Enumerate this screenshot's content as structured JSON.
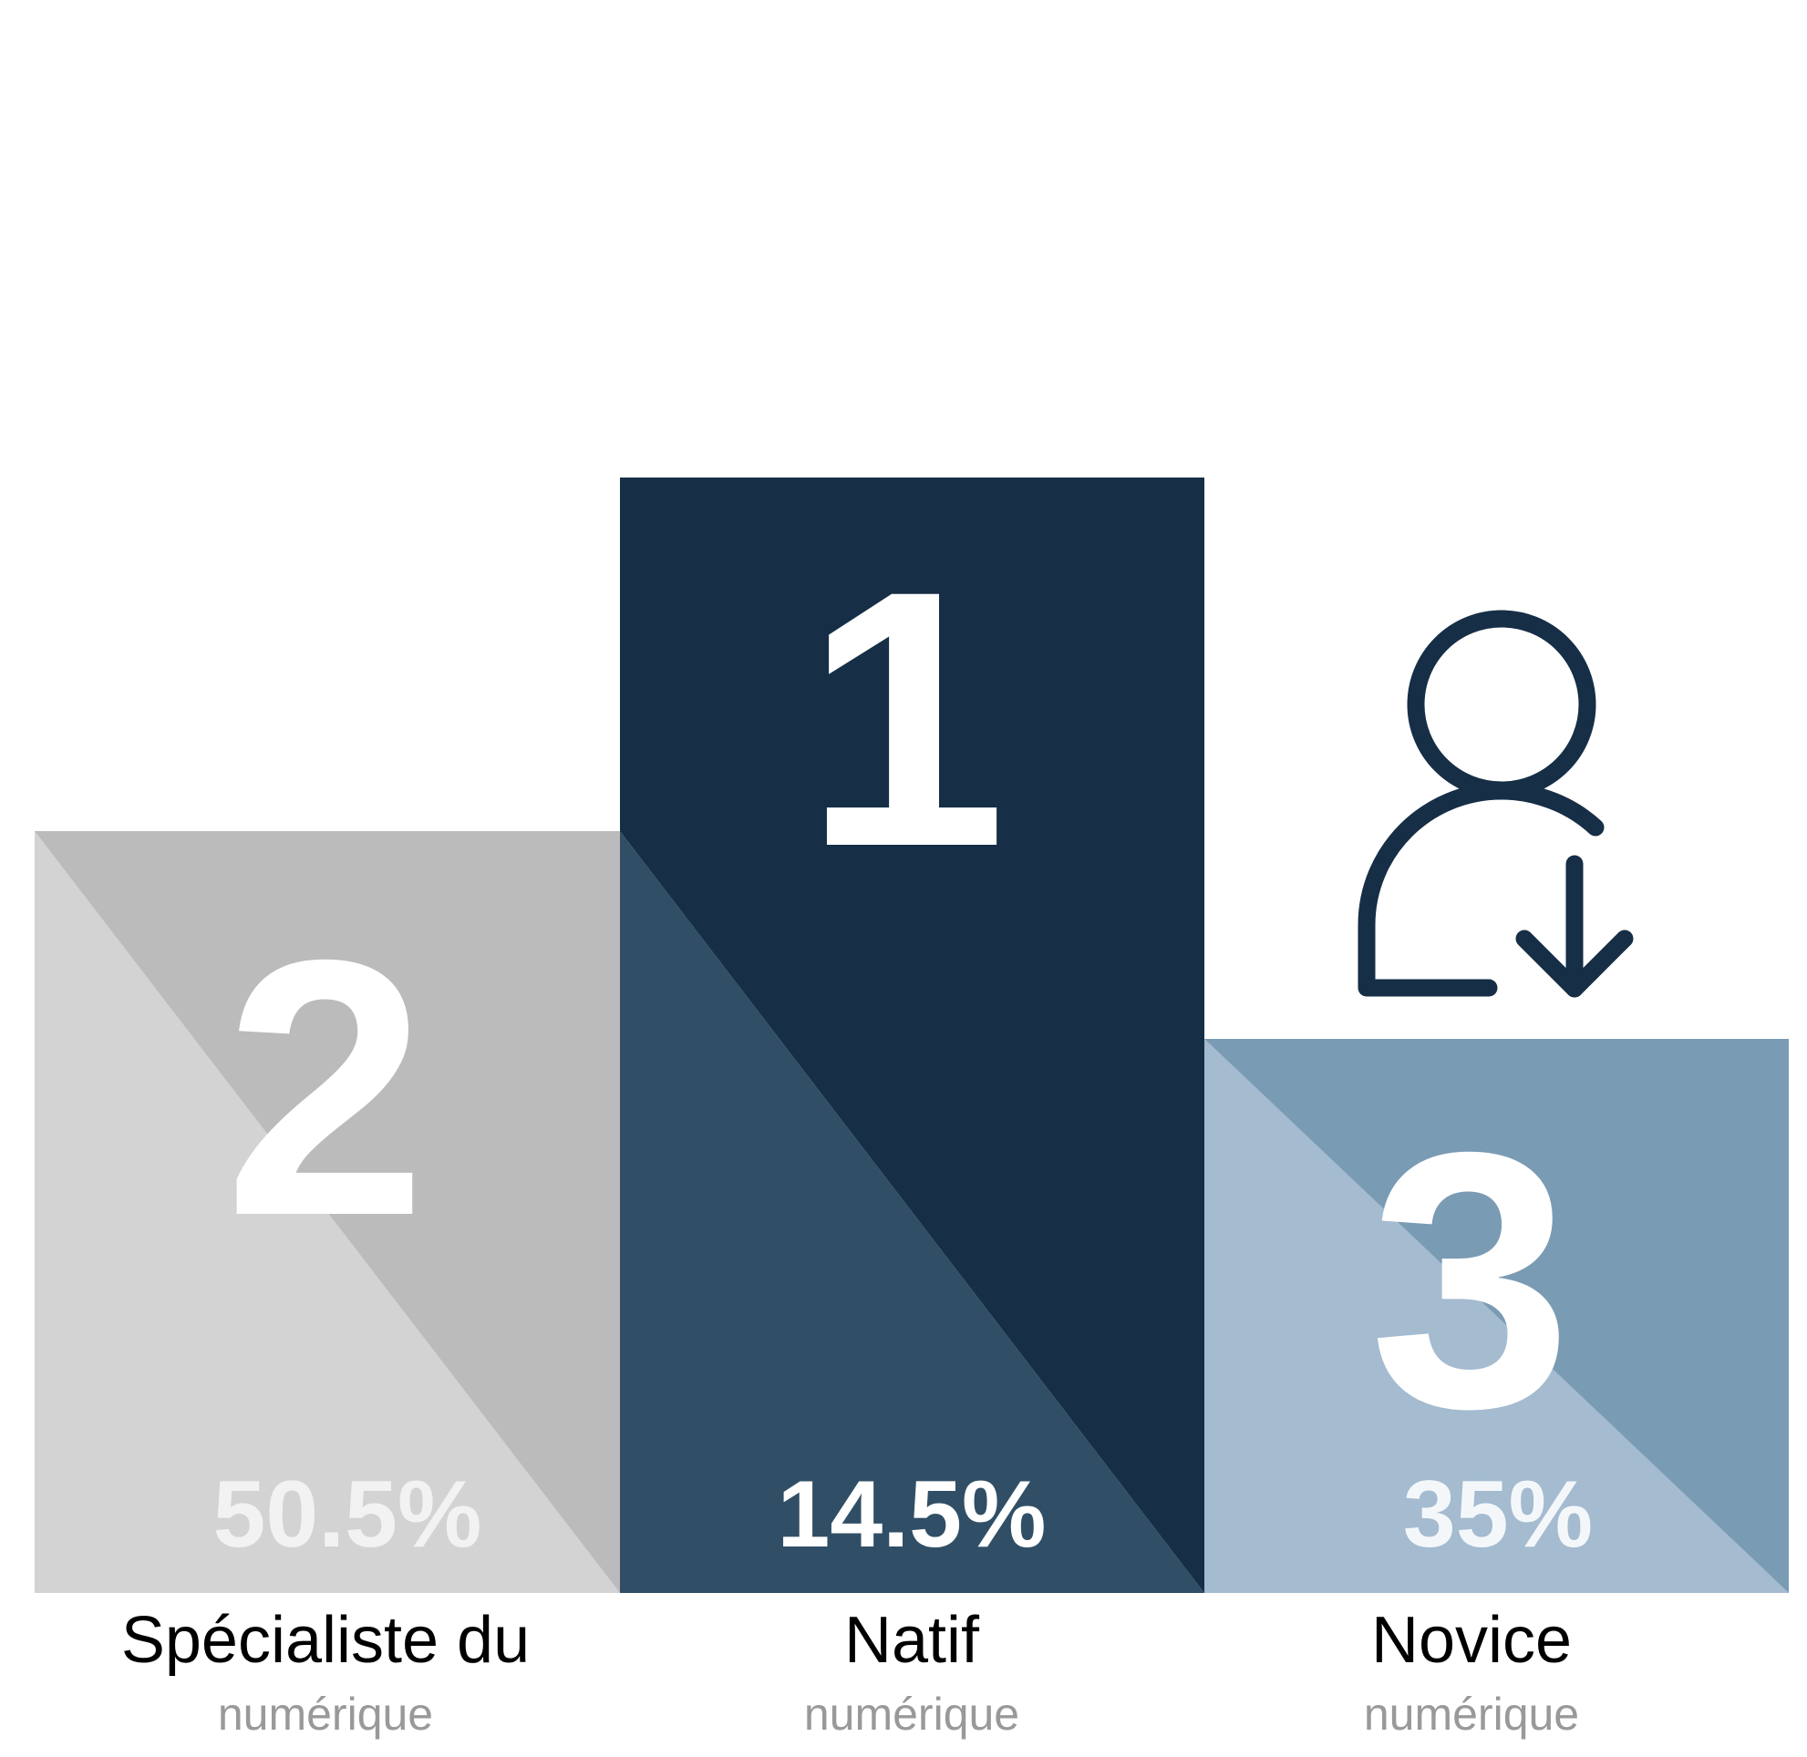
{
  "chart_data": {
    "type": "bar",
    "categories": [
      "Spécialiste du numérique",
      "Natif numérique",
      "Novice numérique"
    ],
    "series": [
      {
        "values": [
          50.5,
          14.5,
          35
        ]
      }
    ],
    "podium": [
      {
        "rank": "2",
        "value": 50.5,
        "value_label": "50.5%",
        "label_line1": "Spécialiste du",
        "label_line2": "numérique",
        "color_light": "#d3d3d3",
        "color_dark": "#bbbbbb",
        "pct_color": "#f2f2f2"
      },
      {
        "rank": "1",
        "value": 14.5,
        "value_label": "14.5%",
        "label_line1": "Natif",
        "label_line2": "numérique",
        "color_light": "#304f66",
        "color_dark": "#162e46",
        "pct_color": "#ffffff"
      },
      {
        "rank": "3",
        "value": 35,
        "value_label": "35%",
        "label_line1": "Novice",
        "label_line2": "numérique",
        "color_light": "#a4bbd0",
        "color_dark": "#7a9bb4",
        "pct_color": "#f4f7fa"
      }
    ],
    "icon": "user-arrow-down-icon",
    "icon_color": "#162e46"
  }
}
